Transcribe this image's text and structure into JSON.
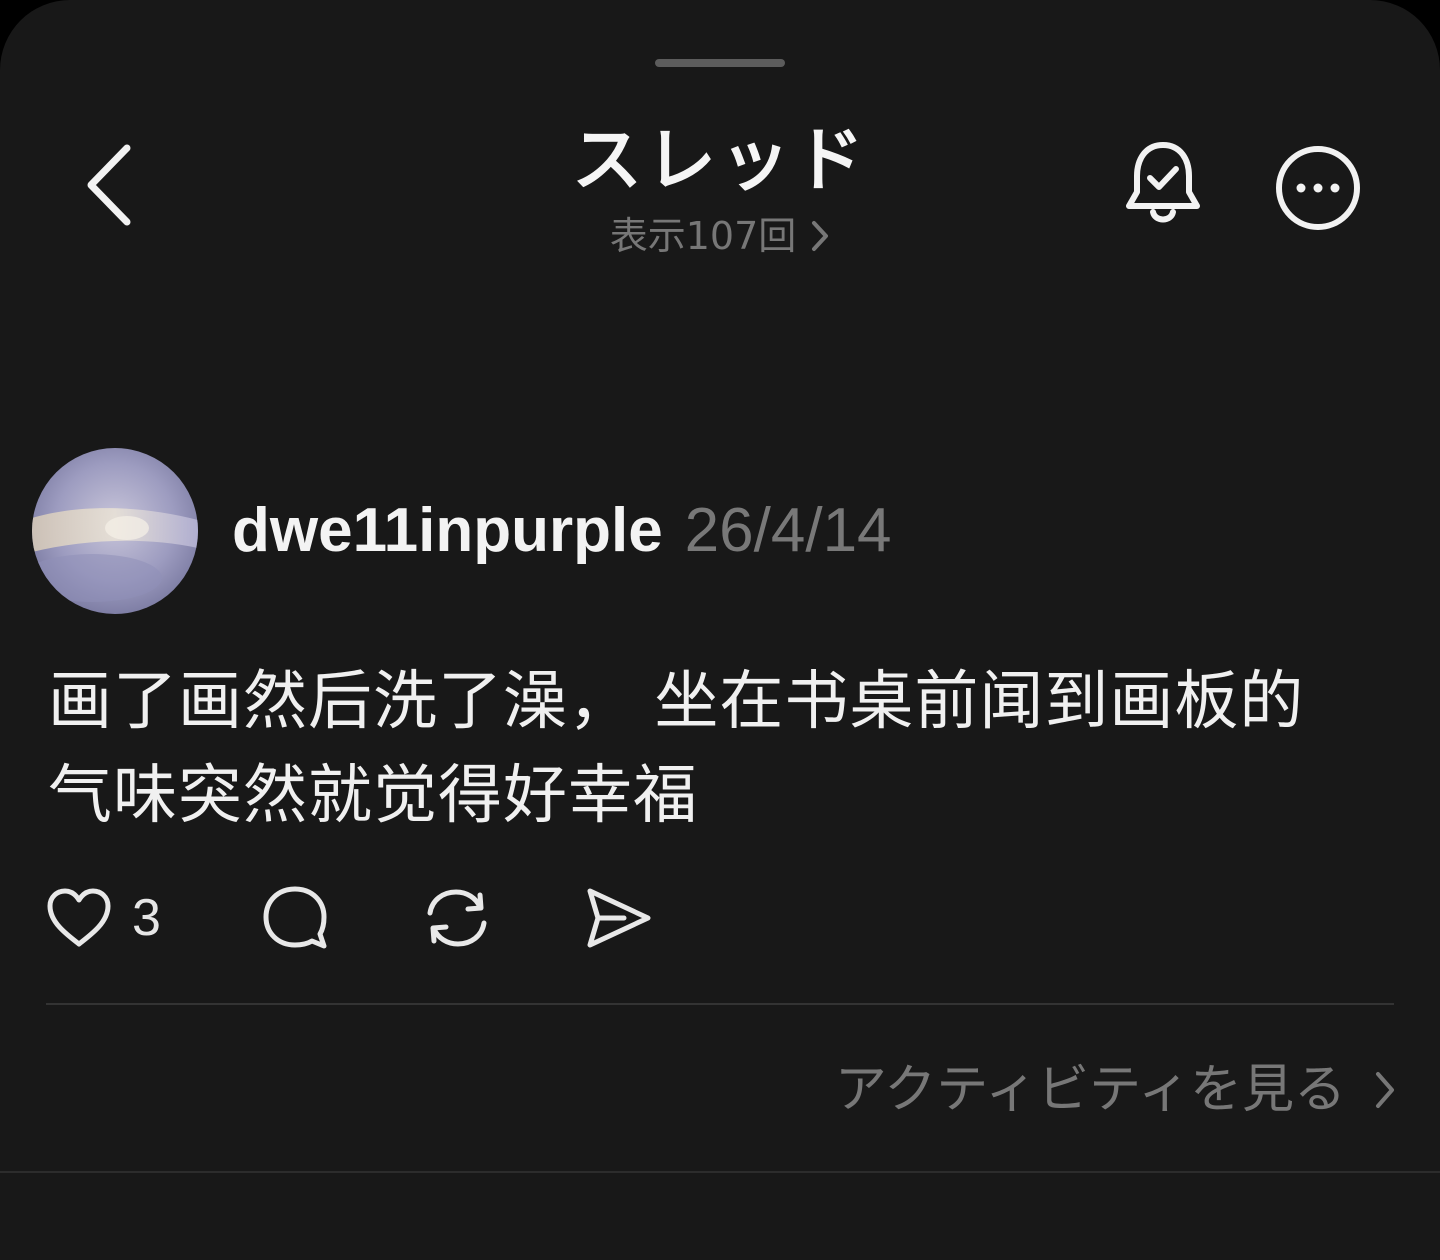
{
  "header": {
    "title": "スレッド",
    "views_label": "表示107回"
  },
  "icons": {
    "back": "chevron-left-icon",
    "notify": "bell-check-icon",
    "more": "more-horizontal-icon",
    "like": "heart-icon",
    "reply": "comment-icon",
    "repost": "repost-icon",
    "share": "send-icon",
    "views_chevron": "chevron-right-icon",
    "activity_chevron": "chevron-right-icon"
  },
  "post": {
    "username": "dwe11inpurple",
    "timestamp": "26/4/14",
    "text_line1": "画了画然后洗了澡， 坐在书桌前闻到画板的",
    "text_line2": "气味突然就觉得好幸福",
    "like_count": "3"
  },
  "footer": {
    "activity_label": "アクティビティを見る"
  },
  "colors": {
    "background": "#181818",
    "text_primary": "#f3f3f3",
    "text_secondary": "#777777",
    "divider": "#333333"
  }
}
